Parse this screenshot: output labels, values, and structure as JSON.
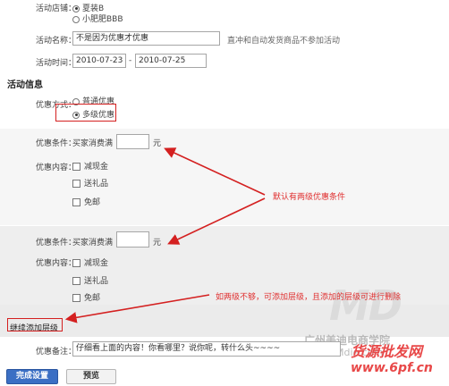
{
  "store": {
    "label": "活动店铺：",
    "options": [
      {
        "label": "夏装B",
        "selected": true
      },
      {
        "label": "小肥肥BBB",
        "selected": false
      }
    ]
  },
  "activity": {
    "name_label": "活动名称：",
    "name_value": "不是因为优惠才优惠",
    "name_hint": "直冲和自动发货商品不参加活动",
    "time_label": "活动时间：",
    "start_date": "2010-07-23",
    "date_sep": "-",
    "end_date": "2010-07-25"
  },
  "section_title": "活动信息",
  "discount_mode": {
    "label": "优惠方式：",
    "options": [
      {
        "label": "普通优惠",
        "selected": false
      },
      {
        "label": "多级优惠",
        "selected": true
      }
    ]
  },
  "tiers": [
    {
      "condition_label": "优惠条件：",
      "condition_prefix": "买家消费满",
      "condition_value": "",
      "condition_unit": "元",
      "content_label": "优惠内容：",
      "options": [
        "减现金",
        "送礼品",
        "免邮"
      ]
    },
    {
      "condition_label": "优惠条件：",
      "condition_prefix": "买家消费满",
      "condition_value": "",
      "condition_unit": "元",
      "content_label": "优惠内容：",
      "options": [
        "减现金",
        "送礼品",
        "免邮"
      ]
    }
  ],
  "add_level_link": "继续添加层级",
  "remark": {
    "label": "优惠备注：",
    "value": "仔细看上面的内容！你看哪里？说你呢，转什么头~~~~"
  },
  "buttons": {
    "confirm": "完成设置",
    "preview": "预览"
  },
  "annotations": {
    "default_two_levels": "默认有两级优惠条件",
    "add_levels": "如两级不够，可添加层级，且添加的层级可进行删除"
  },
  "watermarks": {
    "logo": "MD",
    "company": "广州美迪电商学院",
    "site": "Mdie.com",
    "stamp": "货源批发网",
    "url": "www.6pf.cn"
  },
  "colors": {
    "accent_red": "#d42020",
    "band_gray": "#eeeeee",
    "button_blue": "#3b6fc4",
    "watermark_red": "#e84848"
  }
}
